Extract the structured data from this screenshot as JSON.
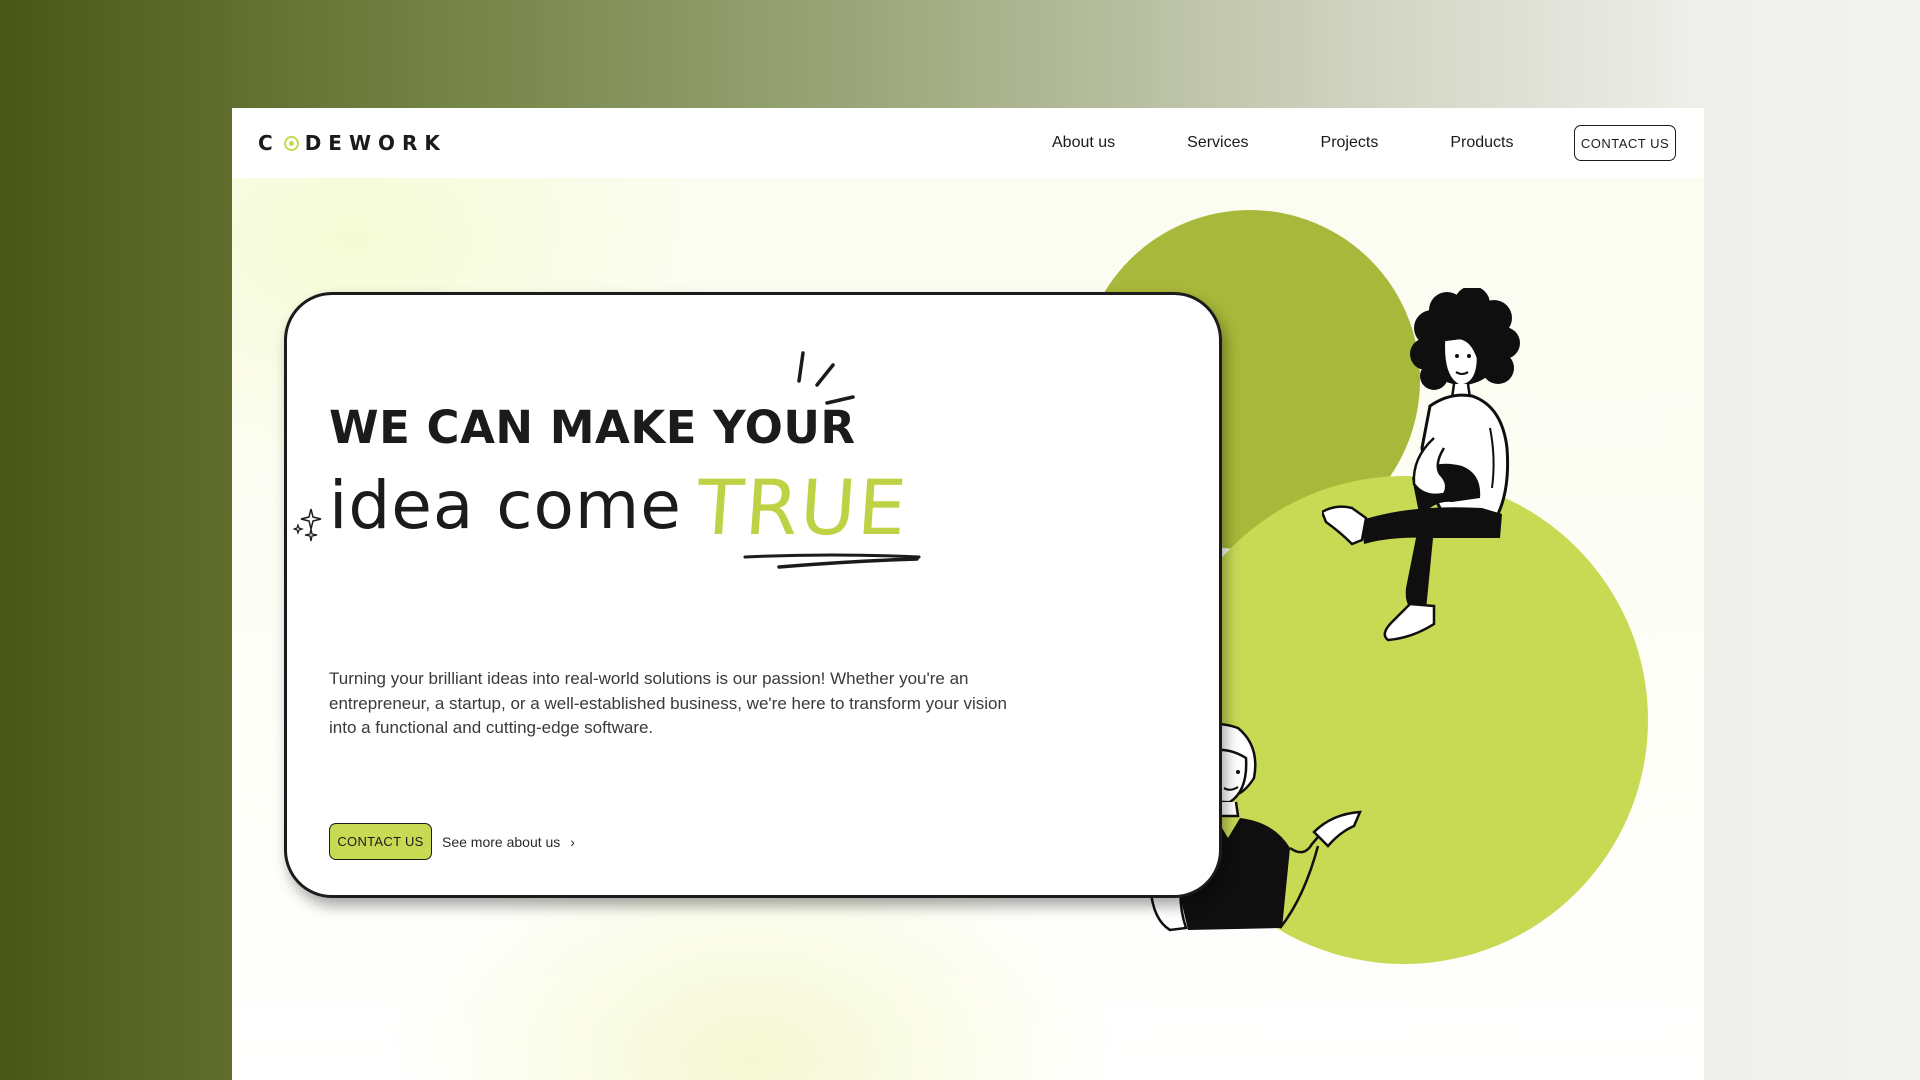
{
  "brand": {
    "logo_text_1": "C",
    "logo_text_2": "DEWORK",
    "accent": "#c8d953"
  },
  "nav": {
    "items": [
      {
        "label": "About us"
      },
      {
        "label": "Services"
      },
      {
        "label": "Projects"
      },
      {
        "label": "Products"
      }
    ],
    "contact_label": "CONTACT US"
  },
  "hero": {
    "line1": "WE CAN MAKE YOUR",
    "line2": "idea come",
    "highlight": "TRUE",
    "description": "Turning your brilliant ideas into real-world solutions is our passion! Whether you're an entrepreneur, a startup, or a well-established business, we're here to transform your vision into a functional and cutting-edge software.",
    "cta_label": "CONTACT US",
    "secondary_label": "See more about us"
  },
  "colors": {
    "accent_light": "#c8d953",
    "accent_dark": "#a8b83a",
    "text": "#1b1b1b",
    "highlight": "#bfd245"
  },
  "icons": [
    "chevron-right-icon",
    "sparkle-icon",
    "burst-lines-icon"
  ]
}
